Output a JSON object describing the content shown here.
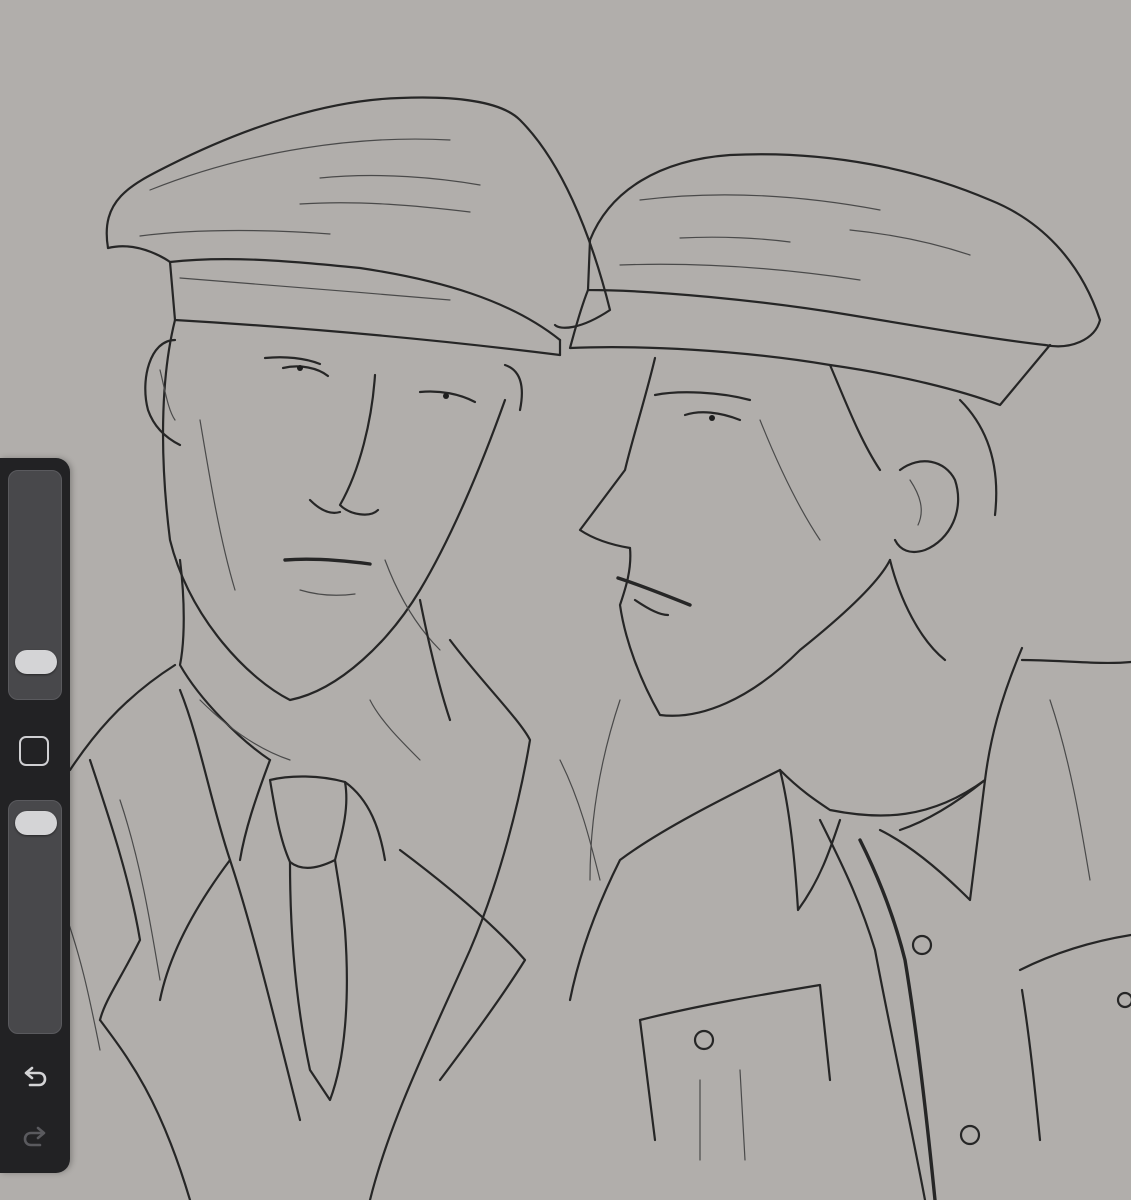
{
  "app": {
    "canvas_background": "#b1aeab",
    "toolbar_background": "#222224"
  },
  "toolbar": {
    "brush_size": {
      "value": 0.1
    },
    "opacity": {
      "value": 0.98
    },
    "modify_icon": "square-outline-icon",
    "undo_icon": "undo-arrow-icon",
    "redo_icon": "redo-arrow-icon",
    "redo_enabled": false
  },
  "artwork": {
    "description_icon": "sketch-artwork"
  }
}
